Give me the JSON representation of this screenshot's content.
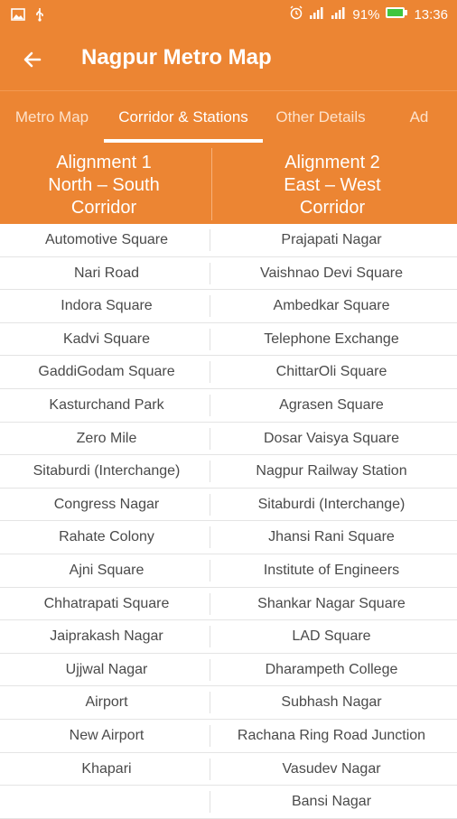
{
  "status": {
    "battery": "91%",
    "time": "13:36",
    "colors": {
      "bar": "#ec8533"
    }
  },
  "appbar": {
    "title": "Nagpur Metro Map",
    "back_icon": "arrow-left-icon"
  },
  "tabs": [
    {
      "label": "Metro Map",
      "active": false
    },
    {
      "label": "Corridor & Stations",
      "active": true
    },
    {
      "label": "Other Details",
      "active": false
    },
    {
      "label": "Ad",
      "active": false
    }
  ],
  "columns": {
    "left": {
      "line1": "Alignment 1",
      "line2": "North – South",
      "line3": "Corridor"
    },
    "right": {
      "line1": "Alignment 2",
      "line2": "East – West",
      "line3": "Corridor"
    }
  },
  "stations": [
    {
      "left": "Automotive Square",
      "right": "Prajapati Nagar"
    },
    {
      "left": "Nari Road",
      "right": "Vaishnao Devi Square"
    },
    {
      "left": "Indora Square",
      "right": "Ambedkar Square"
    },
    {
      "left": "Kadvi Square",
      "right": "Telephone Exchange"
    },
    {
      "left": "GaddiGodam Square",
      "right": "ChittarOli Square"
    },
    {
      "left": "Kasturchand Park",
      "right": "Agrasen Square"
    },
    {
      "left": "Zero Mile",
      "right": "Dosar Vaisya Square"
    },
    {
      "left": "Sitaburdi (Interchange)",
      "right": "Nagpur Railway Station"
    },
    {
      "left": "Congress Nagar",
      "right": "Sitaburdi (Interchange)"
    },
    {
      "left": "Rahate Colony",
      "right": "Jhansi Rani Square"
    },
    {
      "left": "Ajni Square",
      "right": "Institute of Engineers"
    },
    {
      "left": "Chhatrapati Square",
      "right": "Shankar Nagar Square"
    },
    {
      "left": "Jaiprakash Nagar",
      "right": "LAD Square"
    },
    {
      "left": "Ujjwal Nagar",
      "right": "Dharampeth College"
    },
    {
      "left": "Airport",
      "right": "Subhash Nagar"
    },
    {
      "left": "New Airport",
      "right": "Rachana Ring Road Junction"
    },
    {
      "left": "Khapari",
      "right": "Vasudev Nagar"
    },
    {
      "left": "",
      "right": "Bansi Nagar"
    }
  ]
}
